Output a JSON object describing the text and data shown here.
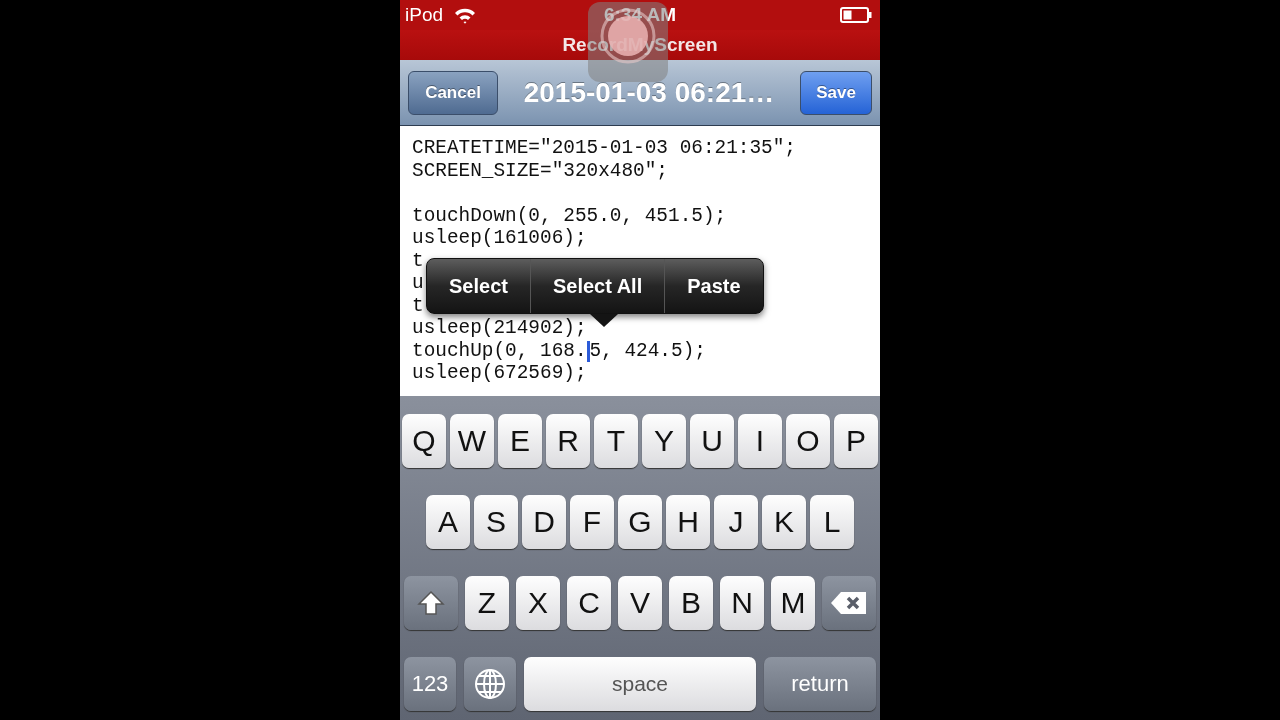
{
  "status_bar": {
    "device": "iPod",
    "time": "6:34 AM"
  },
  "app_banner": {
    "title": "RecordMyScreen"
  },
  "nav_bar": {
    "cancel": "Cancel",
    "title": "2015-01-03 06:21…",
    "save": "Save"
  },
  "editor": {
    "lines": [
      {
        "kind": "text",
        "text": "CREATETIME=\"2015-01-03 06:21:35\";"
      },
      {
        "kind": "text",
        "text": "SCREEN_SIZE=\"320x480\";"
      },
      {
        "kind": "blank"
      },
      {
        "kind": "text",
        "text": "touchDown(0, 255.0, 451.5);"
      },
      {
        "kind": "text",
        "text": "usleep(161006);"
      },
      {
        "kind": "text",
        "text": "t"
      },
      {
        "kind": "text",
        "text": "u"
      },
      {
        "kind": "text",
        "text": "t"
      },
      {
        "kind": "text",
        "text": "usleep(214902);"
      },
      {
        "kind": "cursor",
        "before": "touchUp(0, 168.",
        "after": "5, 424.5);"
      },
      {
        "kind": "text",
        "text": "usleep(672569);"
      }
    ]
  },
  "edit_menu": [
    "Select",
    "Select All",
    "Paste"
  ],
  "keyboard": {
    "rows": [
      [
        {
          "kind": "letter",
          "label": "Q"
        },
        {
          "kind": "letter",
          "label": "W"
        },
        {
          "kind": "letter",
          "label": "E"
        },
        {
          "kind": "letter",
          "label": "R"
        },
        {
          "kind": "letter",
          "label": "T"
        },
        {
          "kind": "letter",
          "label": "Y"
        },
        {
          "kind": "letter",
          "label": "U"
        },
        {
          "kind": "letter",
          "label": "I"
        },
        {
          "kind": "letter",
          "label": "O"
        },
        {
          "kind": "letter",
          "label": "P"
        }
      ],
      [
        {
          "kind": "letter",
          "label": "A"
        },
        {
          "kind": "letter",
          "label": "S"
        },
        {
          "kind": "letter",
          "label": "D"
        },
        {
          "kind": "letter",
          "label": "F"
        },
        {
          "kind": "letter",
          "label": "G"
        },
        {
          "kind": "letter",
          "label": "H"
        },
        {
          "kind": "letter",
          "label": "J"
        },
        {
          "kind": "letter",
          "label": "K"
        },
        {
          "kind": "letter",
          "label": "L"
        }
      ],
      [
        {
          "kind": "shift"
        },
        {
          "kind": "letter",
          "label": "Z"
        },
        {
          "kind": "letter",
          "label": "X"
        },
        {
          "kind": "letter",
          "label": "C"
        },
        {
          "kind": "letter",
          "label": "V"
        },
        {
          "kind": "letter",
          "label": "B"
        },
        {
          "kind": "letter",
          "label": "N"
        },
        {
          "kind": "letter",
          "label": "M"
        },
        {
          "kind": "delete"
        }
      ]
    ],
    "bottom_row": [
      {
        "kind": "numbers",
        "label": "123"
      },
      {
        "kind": "globe"
      },
      {
        "kind": "space",
        "label": "space"
      },
      {
        "kind": "return",
        "label": "return"
      }
    ]
  }
}
